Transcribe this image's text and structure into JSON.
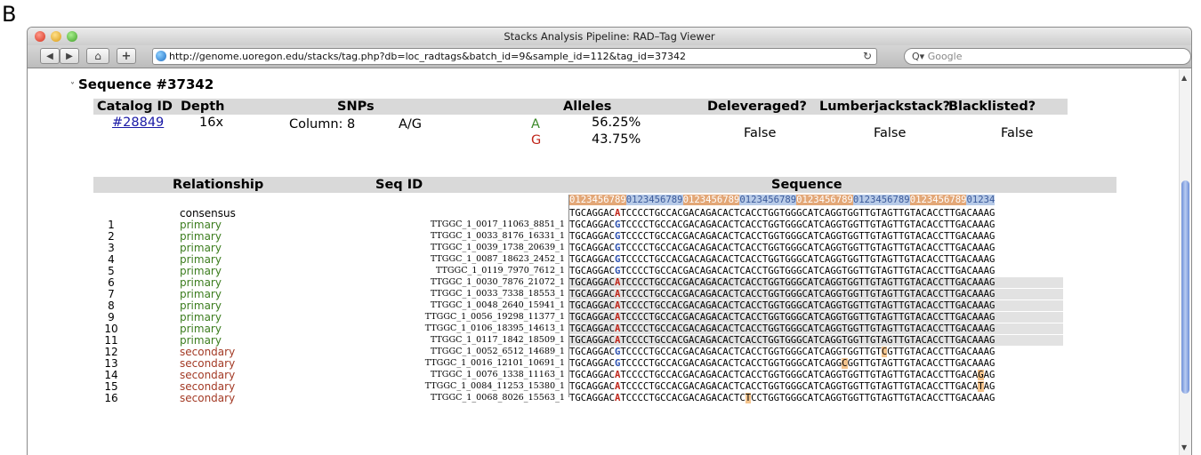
{
  "figure_label": "B",
  "window": {
    "title": "Stacks Analysis Pipeline: RAD–Tag Viewer",
    "url": "http://genome.uoregon.edu/stacks/tag.php?db=loc_radtags&batch_id=9&sample_id=112&tag_id=37342",
    "search_placeholder": "Google",
    "search_prefix": "Q▾"
  },
  "heading": "Sequence #37342",
  "summary": {
    "headers": [
      "Catalog ID",
      "Depth",
      "SNPs",
      "Alleles",
      "Deleveraged?",
      "Lumberjackstack?",
      "Blacklisted?"
    ],
    "catalog_id": "#28849",
    "depth": "16x",
    "snp_column": "Column: 8",
    "snp_alleles": "A/G",
    "alleles": [
      {
        "base": "A",
        "freq": "56.25%",
        "color": "#3c8a2a"
      },
      {
        "base": "G",
        "freq": "43.75%",
        "color": "#c0261a"
      }
    ],
    "deleveraged": "False",
    "lumberjackstack": "False",
    "blacklisted": "False"
  },
  "table": {
    "headers": [
      "Relationship",
      "Seq ID",
      "Sequence"
    ],
    "ruler": [
      "0123456789",
      "0123456789",
      "0123456789",
      "0123456789",
      "0123456789",
      "0123456789",
      "0123456789",
      "01234"
    ],
    "ruler_colors": [
      "#e3a777",
      "#b8cbe8"
    ],
    "rows": [
      {
        "num": "",
        "rel": "consensus",
        "seq_id": "",
        "shaded": false,
        "seq": "TGCAGGAC{A}TCCCCTGCCACGACAGACACTCACCTGGTGGGCATCAGGTGGTTGTAGTTGTACACCTTGACAAAG"
      },
      {
        "num": "1",
        "rel": "primary",
        "seq_id": "TTGGC_1_0017_11063_8851_1",
        "shaded": false,
        "seq": "TGCAGGAC[G]TCCCCTGCCACGACAGACACTCACCTGGTGGGCATCAGGTGGTTGTAGTTGTACACCTTGACAAAG"
      },
      {
        "num": "2",
        "rel": "primary",
        "seq_id": "TTGGC_1_0033_8176_16331_1",
        "shaded": false,
        "seq": "TGCAGGAC[G]TCCCCTGCCACGACAGACACTCACCTGGTGGGCATCAGGTGGTTGTAGTTGTACACCTTGACAAAG"
      },
      {
        "num": "3",
        "rel": "primary",
        "seq_id": "TTGGC_1_0039_1738_20639_1",
        "shaded": false,
        "seq": "TGCAGGAC[G]TCCCCTGCCACGACAGACACTCACCTGGTGGGCATCAGGTGGTTGTAGTTGTACACCTTGACAAAG"
      },
      {
        "num": "4",
        "rel": "primary",
        "seq_id": "TTGGC_1_0087_18623_2452_1",
        "shaded": false,
        "seq": "TGCAGGAC[G]TCCCCTGCCACGACAGACACTCACCTGGTGGGCATCAGGTGGTTGTAGTTGTACACCTTGACAAAG"
      },
      {
        "num": "5",
        "rel": "primary",
        "seq_id": "TTGGC_1_0119_7970_7612_1",
        "shaded": false,
        "seq": "TGCAGGAC[G]TCCCCTGCCACGACAGACACTCACCTGGTGGGCATCAGGTGGTTGTAGTTGTACACCTTGACAAAG"
      },
      {
        "num": "6",
        "rel": "primary",
        "seq_id": "TTGGC_1_0030_7876_21072_1",
        "shaded": true,
        "seq": "TGCAGGAC{A}TCCCCTGCCACGACAGACACTCACCTGGTGGGCATCAGGTGGTTGTAGTTGTACACCTTGACAAAG"
      },
      {
        "num": "7",
        "rel": "primary",
        "seq_id": "TTGGC_1_0033_7338_18553_1",
        "shaded": true,
        "seq": "TGCAGGAC{A}TCCCCTGCCACGACAGACACTCACCTGGTGGGCATCAGGTGGTTGTAGTTGTACACCTTGACAAAG"
      },
      {
        "num": "8",
        "rel": "primary",
        "seq_id": "TTGGC_1_0048_2640_15941_1",
        "shaded": true,
        "seq": "TGCAGGAC{A}TCCCCTGCCACGACAGACACTCACCTGGTGGGCATCAGGTGGTTGTAGTTGTACACCTTGACAAAG"
      },
      {
        "num": "9",
        "rel": "primary",
        "seq_id": "TTGGC_1_0056_19298_11377_1",
        "shaded": true,
        "seq": "TGCAGGAC{A}TCCCCTGCCACGACAGACACTCACCTGGTGGGCATCAGGTGGTTGTAGTTGTACACCTTGACAAAG"
      },
      {
        "num": "10",
        "rel": "primary",
        "seq_id": "TTGGC_1_0106_18395_14613_1",
        "shaded": true,
        "seq": "TGCAGGAC{A}TCCCCTGCCACGACAGACACTCACCTGGTGGGCATCAGGTGGTTGTAGTTGTACACCTTGACAAAG"
      },
      {
        "num": "11",
        "rel": "primary",
        "seq_id": "TTGGC_1_0117_1842_18509_1",
        "shaded": true,
        "seq": "TGCAGGAC{A}TCCCCTGCCACGACAGACACTCACCTGGTGGGCATCAGGTGGTTGTAGTTGTACACCTTGACAAAG"
      },
      {
        "num": "12",
        "rel": "secondary",
        "seq_id": "TTGGC_1_0052_6512_14689_1",
        "shaded": false,
        "seq": "TGCAGGAC[G]TCCCCTGCCACGACAGACACTCACCTGGTGGGCATCAGGTGGTTGT<C>GTTGTACACCTTGACAAAG"
      },
      {
        "num": "13",
        "rel": "secondary",
        "seq_id": "TTGGC_1_0016_12101_10691_1",
        "shaded": false,
        "seq": "TGCAGGAC[G]TCCCCTGCCACGACAGACACTCACCTGGTGGGCATCAGG<C>GGTTGTAGTTGTACACCTTGACAAAG"
      },
      {
        "num": "14",
        "rel": "secondary",
        "seq_id": "TTGGC_1_0076_1338_11163_1",
        "shaded": false,
        "seq": "TGCAGGAC{A}TCCCCTGCCACGACAGACACTCACCTGGTGGGCATCAGGTGGTTGTAGTTGTACACCTTGACA<G>AG"
      },
      {
        "num": "15",
        "rel": "secondary",
        "seq_id": "TTGGC_1_0084_11253_15380_1",
        "shaded": false,
        "seq": "TGCAGGAC{A}TCCCCTGCCACGACAGACACTCACCTGGTGGGCATCAGGTGGTTGTAGTTGTACACCTTGACA<T>AG"
      },
      {
        "num": "16",
        "rel": "secondary",
        "seq_id": "TTGGC_1_0068_8026_15563_1",
        "shaded": false,
        "seq": "TGCAGGAC{A}TCCCCTGCCACGACAGACACTC<T>CCTGGTGGGCATCAGGTGGTTGTAGTTGTACACCTTGACAAAG"
      }
    ]
  }
}
